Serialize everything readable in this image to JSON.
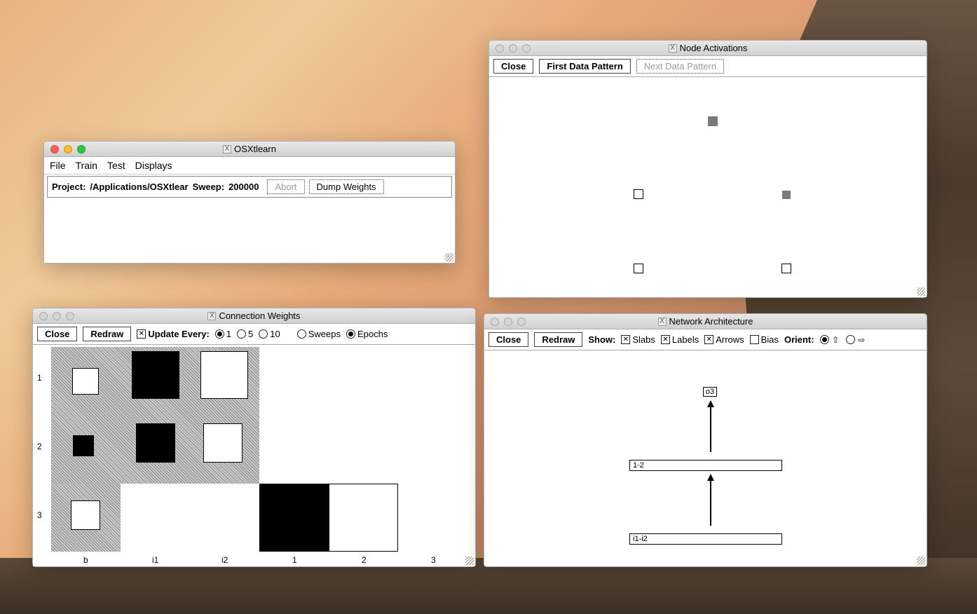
{
  "main_window": {
    "title": "OSXtlearn",
    "menu": [
      "File",
      "Train",
      "Test",
      "Displays"
    ],
    "project_label": "Project:",
    "project_path": "/Applications/OSXtlear",
    "sweep_label": "Sweep:",
    "sweep_value": "200000",
    "abort_btn": "Abort",
    "dump_btn": "Dump Weights"
  },
  "node_window": {
    "title": "Node Activations",
    "close_btn": "Close",
    "first_btn": "First Data Pattern",
    "next_btn": "Next Data Pattern"
  },
  "conn_window": {
    "title": "Connection Weights",
    "close_btn": "Close",
    "redraw_btn": "Redraw",
    "update_label": "Update Every:",
    "radio_1": "1",
    "radio_5": "5",
    "radio_10": "10",
    "radio_sweeps": "Sweeps",
    "radio_epochs": "Epochs",
    "row_labels": [
      "1",
      "2",
      "3"
    ],
    "col_labels": [
      "b",
      "i1",
      "i2",
      "1",
      "2",
      "3"
    ]
  },
  "net_window": {
    "title": "Network Architecture",
    "close_btn": "Close",
    "redraw_btn": "Redraw",
    "show_label": "Show:",
    "chk_slabs": "Slabs",
    "chk_labels": "Labels",
    "chk_arrows": "Arrows",
    "chk_bias": "Bias",
    "orient_label": "Orient:",
    "node_o3": "o3",
    "node_hidden": "1-2",
    "node_input": "i1-i2"
  }
}
